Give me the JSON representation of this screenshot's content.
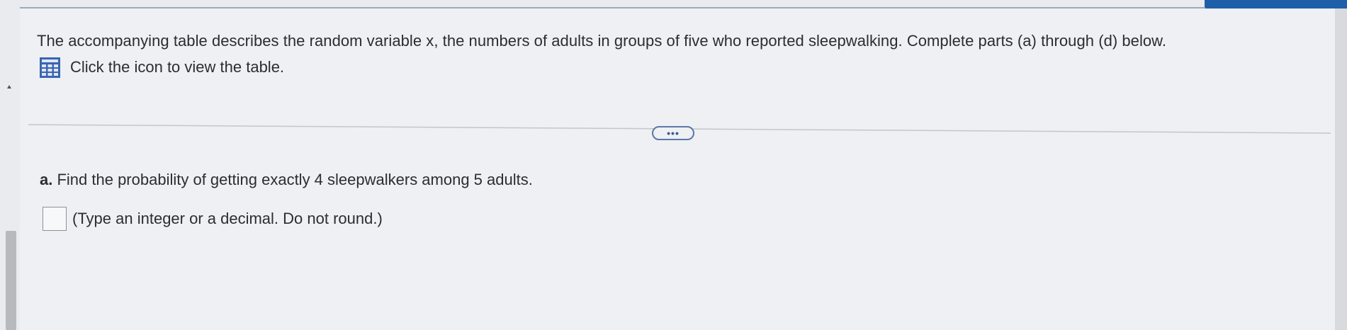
{
  "intro_text": "The accompanying table describes the random variable x, the numbers of adults in groups of five who reported sleepwalking. Complete parts (a) through (d) below.",
  "table_link": {
    "icon": "table-grid-icon",
    "label": "Click the icon to view the table."
  },
  "more_button": {
    "label": "•••"
  },
  "question_a": {
    "letter": "a.",
    "text": " Find the probability of getting exactly 4 sleepwalkers among 5 adults."
  },
  "answer_a": {
    "value": "",
    "hint": "(Type an integer or a decimal. Do not round.)"
  },
  "colors": {
    "accent": "#1f5fa8",
    "icon_blue": "#3a64b4",
    "background": "#eef0f3"
  }
}
